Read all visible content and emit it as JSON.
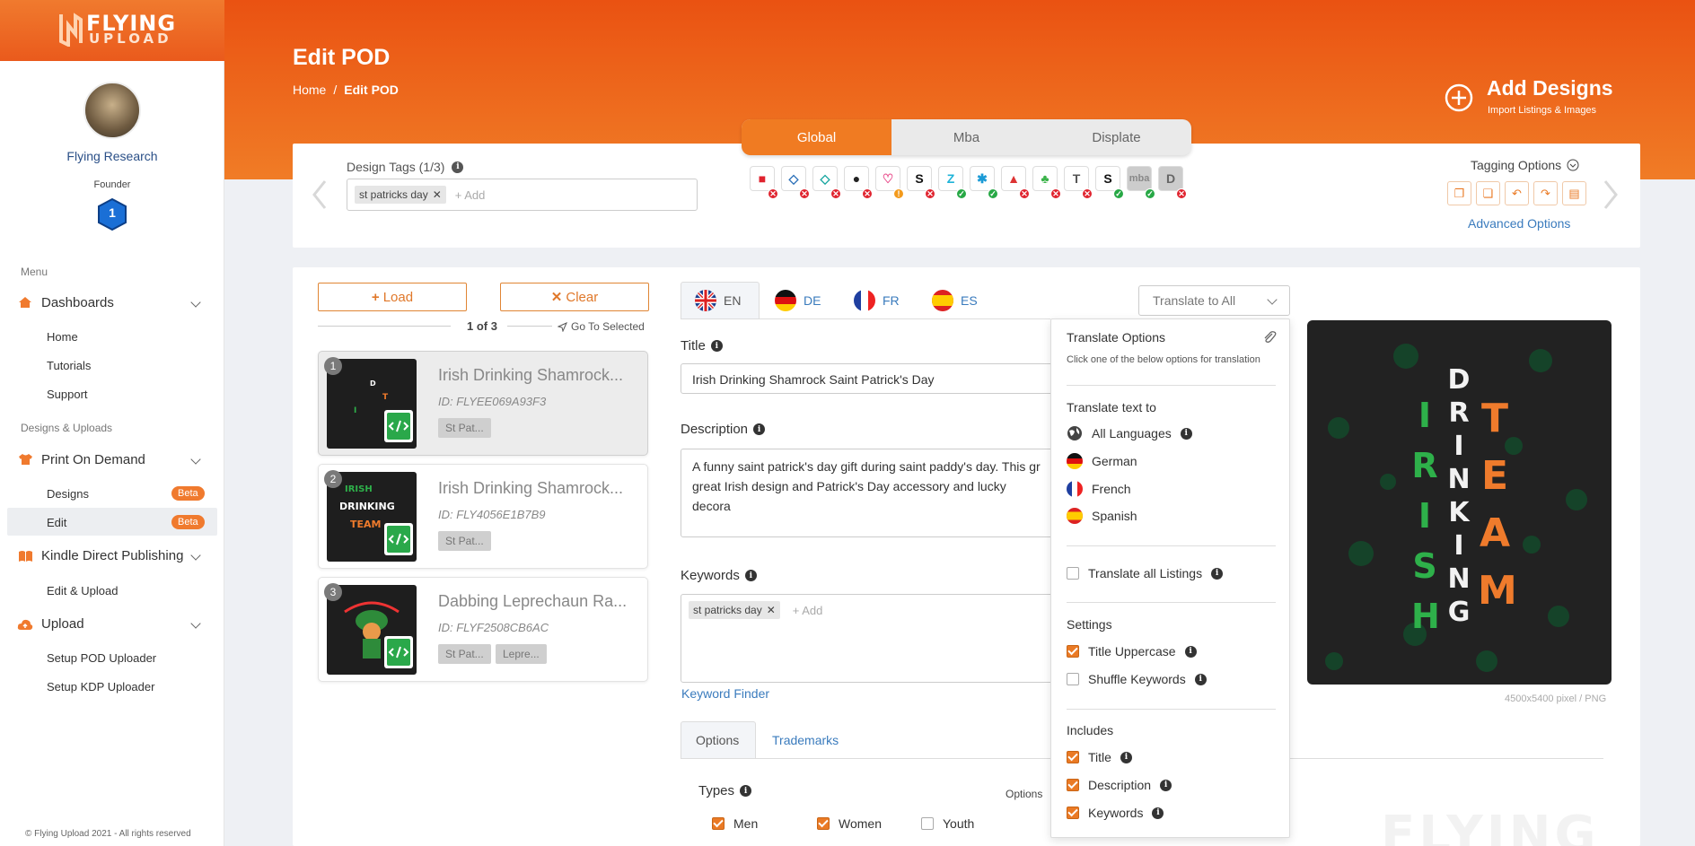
{
  "brand": {
    "logo_line1": "FLYING",
    "logo_line2": "UPLOAD",
    "primary": "#ea5a1c",
    "accent": "#f07a2e"
  },
  "user": {
    "name": "Flying Research",
    "role": "Founder",
    "level": "1"
  },
  "sidebar": {
    "menu_label": "Menu",
    "dashboards": "Dashboards",
    "dash_items": [
      "Home",
      "Tutorials",
      "Support"
    ],
    "section_designs": "Designs & Uploads",
    "pod": "Print On Demand",
    "pod_items": [
      {
        "label": "Designs",
        "badge": "Beta"
      },
      {
        "label": "Edit",
        "badge": "Beta"
      }
    ],
    "kdp": "Kindle Direct Publishing",
    "kdp_items": [
      "Edit & Upload"
    ],
    "upload": "Upload",
    "upload_items": [
      "Setup POD Uploader",
      "Setup KDP Uploader"
    ],
    "footer": "© Flying Upload 2021 - All rights reserved"
  },
  "header": {
    "title": "Edit POD",
    "crumb_home": "Home",
    "crumb_sep": "/",
    "crumb_current": "Edit POD",
    "add_title": "Add Designs",
    "add_sub": "Import Listings & Images"
  },
  "platform_tabs": [
    "Global",
    "Mba",
    "Displate"
  ],
  "design_tags": {
    "label": "Design Tags (1/3)",
    "tag": "st patricks day",
    "add": "+ Add"
  },
  "tagging": {
    "label": "Tagging Options",
    "advanced": "Advanced Options"
  },
  "list": {
    "load": "Load",
    "clear": "Clear",
    "pager": "1 of 3",
    "goto": "Go To Selected",
    "items": [
      {
        "n": "1",
        "title": "Irish Drinking Shamrock...",
        "id": "ID: FLYEE069A93F3",
        "tags": [
          "St Pat..."
        ]
      },
      {
        "n": "2",
        "title": "Irish Drinking Shamrock...",
        "id": "ID: FLY4056E1B7B9",
        "tags": [
          "St Pat..."
        ]
      },
      {
        "n": "3",
        "title": "Dabbing Leprechaun Ra...",
        "id": "ID: FLYF2508CB6AC",
        "tags": [
          "St Pat...",
          "Lepre..."
        ]
      }
    ]
  },
  "lang_tabs": [
    "EN",
    "DE",
    "FR",
    "ES"
  ],
  "translate_all": "Translate to All",
  "form": {
    "title_label": "Title",
    "title_value": "Irish Drinking Shamrock Saint Patrick's Day",
    "desc_label": "Description",
    "desc_value": "A funny saint patrick's day gift during saint paddy's day. This gr great Irish design and Patrick's Day accessory and lucky decora",
    "kw_label": "Keywords",
    "kw_tag": "st patricks day",
    "kw_add": "+ Add",
    "kw_finder": "Keyword Finder",
    "tabs": [
      "Options",
      "Trademarks"
    ],
    "types_label": "Types",
    "types": [
      {
        "label": "Men",
        "checked": true
      },
      {
        "label": "Women",
        "checked": true
      },
      {
        "label": "Youth",
        "checked": false
      }
    ],
    "options_label": "Options"
  },
  "translate_dd": {
    "title": "Translate Options",
    "subtitle": "Click one of the below options for translation",
    "text_to": "Translate text to",
    "langs": [
      "All Languages",
      "German",
      "French",
      "Spanish"
    ],
    "all_listings": "Translate all Listings",
    "settings": "Settings",
    "title_upper": "Title Uppercase",
    "shuffle": "Shuffle Keywords",
    "includes": "Includes",
    "inc": [
      "Title",
      "Description",
      "Keywords"
    ]
  },
  "preview": {
    "meta": "4500x5400 pixel / PNG",
    "art_irish": "IRISH",
    "art_drinking": "DRINKING",
    "art_team": "TEAM",
    "watermark": "FLYING"
  }
}
